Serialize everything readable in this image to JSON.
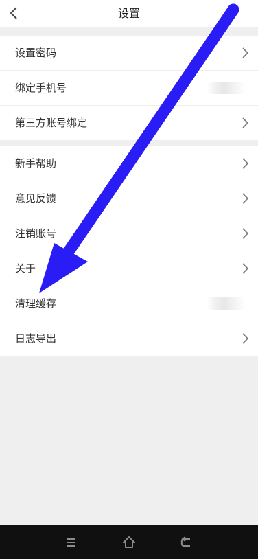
{
  "header": {
    "title": "设置"
  },
  "groups": [
    {
      "items": [
        {
          "label": "设置密码"
        },
        {
          "label": "绑定手机号"
        },
        {
          "label": "第三方账号绑定"
        }
      ]
    },
    {
      "items": [
        {
          "label": "新手帮助"
        },
        {
          "label": "意见反馈"
        },
        {
          "label": "注销账号"
        },
        {
          "label": "关于"
        },
        {
          "label": "清理缓存"
        },
        {
          "label": "日志导出"
        }
      ]
    }
  ],
  "colors": {
    "accent_arrow": "#2a1cf5",
    "background": "#efefef",
    "nav_bar": "#101010"
  },
  "icons": {
    "back": "chevron-left-icon",
    "row_chevron": "chevron-right-icon",
    "nav_menu": "menu-icon",
    "nav_home": "home-icon",
    "nav_back": "back-icon"
  }
}
